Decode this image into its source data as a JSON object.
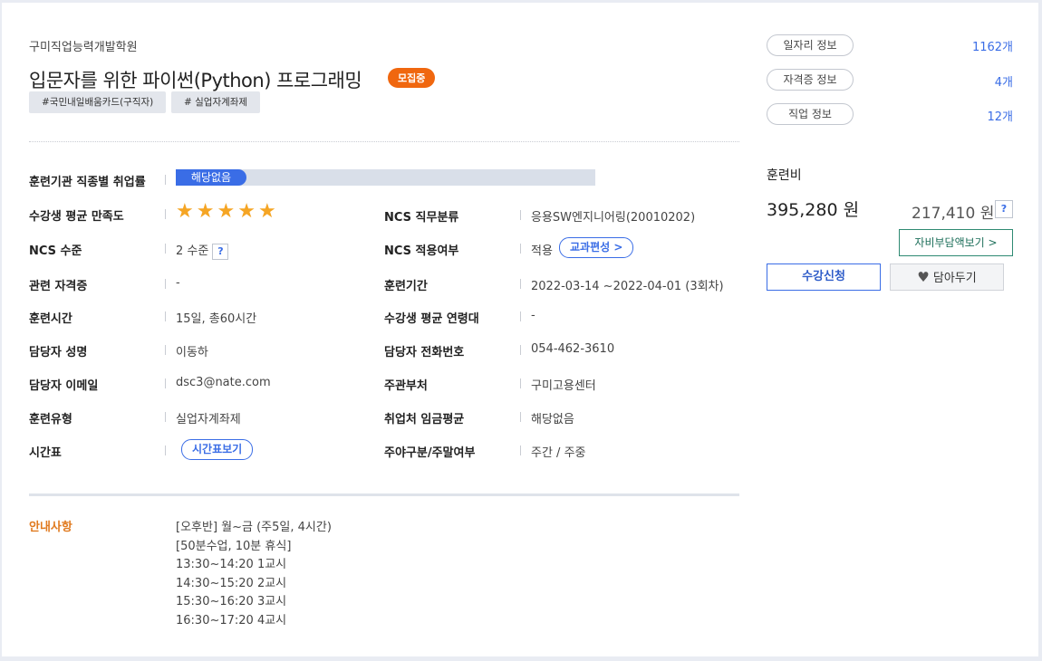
{
  "header": {
    "academy": "구미직업능력개발학원",
    "title": "입문자를 위한 파이썬(Python) 프로그래밍",
    "status_badge": "모집중",
    "tags": [
      "#국민내일배움카드(구직자)",
      "# 실업자계좌제"
    ]
  },
  "details": {
    "employment_rate": {
      "label": "훈련기관 직종별 취업률",
      "value": "해당없음"
    },
    "satisfaction": {
      "label": "수강생 평균 만족도",
      "stars": 5,
      "max_stars": 5
    },
    "ncs_classification": {
      "label": "NCS 직무분류",
      "value": "응용SW엔지니어링(20010202)"
    },
    "ncs_level": {
      "label": "NCS 수준",
      "value": "2 수준",
      "help": "?"
    },
    "ncs_applied": {
      "label": "NCS 적용여부",
      "value": "적용",
      "button": "교과편성 >"
    },
    "related_cert": {
      "label": "관련 자격증",
      "value": "-"
    },
    "training_period": {
      "label": "훈련기간",
      "value": "2022-03-14 ~2022-04-01 (3회차)"
    },
    "training_hours": {
      "label": "훈련시간",
      "value": "15일, 총60시간"
    },
    "avg_age": {
      "label": "수강생 평균 연령대",
      "value": "-"
    },
    "manager_name": {
      "label": "담당자 성명",
      "value": "이동하"
    },
    "manager_phone": {
      "label": "담당자 전화번호",
      "value": "054-462-3610"
    },
    "manager_email": {
      "label": "담당자 이메일",
      "value": "dsc3@nate.com"
    },
    "supervising_office": {
      "label": "주관부처",
      "value": "구미고용센터"
    },
    "training_type": {
      "label": "훈련유형",
      "value": "실업자계좌제"
    },
    "avg_wage": {
      "label": "취업처 임금평균",
      "value": "해당없음"
    },
    "timetable": {
      "label": "시간표",
      "button": "시간표보기"
    },
    "day_weekend": {
      "label": "주야구분/주말여부",
      "value": "주간 / 주중"
    }
  },
  "notice": {
    "label": "안내사항",
    "lines": [
      "[오후반] 월~금 (주5일, 4시간)",
      "[50분수업, 10분 휴식]",
      "13:30~14:20 1교시",
      "14:30~15:20 2교시",
      "15:30~16:20 3교시",
      "16:30~17:20 4교시"
    ]
  },
  "side": {
    "links": [
      {
        "label": "일자리 정보",
        "count": "1162개"
      },
      {
        "label": "자격증 정보",
        "count": "4개"
      },
      {
        "label": "직업 정보",
        "count": "12개"
      }
    ],
    "fee_label": "훈련비",
    "fee_main": "395,280 원",
    "fee_sub": "217,410 원",
    "fee_help": "?",
    "selfpay_button": "자비부담액보기 >",
    "apply_button": "수강신청",
    "wish_button": "담아두기"
  },
  "colors": {
    "accent": "#3a6de6",
    "badge": "#f0670f",
    "star": "#f5a524",
    "notice": "#e07a1f"
  }
}
